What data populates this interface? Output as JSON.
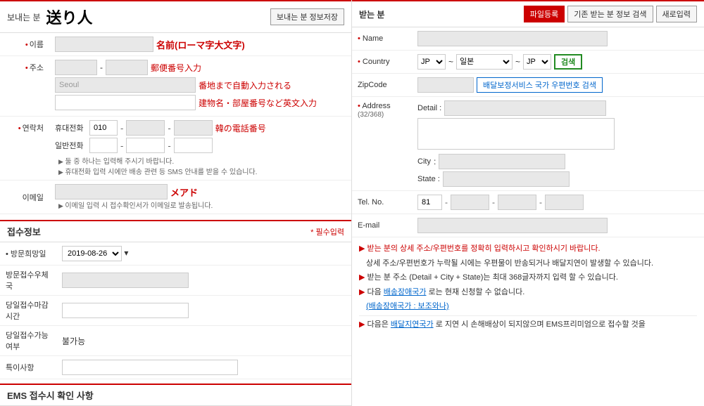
{
  "left": {
    "sender_section": {
      "title_small": "보내는 분",
      "title_large": "送り人",
      "save_btn": "보내는 분 정보저장"
    },
    "form": {
      "name_label": "이름",
      "name_annotation": "名前(ローマ字大文字)",
      "name_placeholder": "",
      "address_label": "주소",
      "postal_annotation": "郵便番号入力",
      "postal_placeholder": "",
      "postal_input2": "",
      "address_line1": "Seoul",
      "address_annotation1": "番地まで自動入力される",
      "address_line2": "",
      "address_annotation2": "建物名・部屋番号など英文入力",
      "contact_label": "연락처",
      "mobile_label": "휴대전화",
      "mobile_prefix": "010",
      "mobile_2": "",
      "mobile_3": "",
      "mobile_annotation": "韓の電話番号",
      "landline_label": "일반전화",
      "landline_2": "",
      "landline_3": "",
      "note1": "둘 중 하나는 입력해 주시기 바랍니다.",
      "note2": "휴대전화 입력 시에만 배송 관련 등 SMS 안내를 받을 수 있습니다.",
      "email_label": "이메일",
      "email_annotation": "メアド",
      "email_placeholder": "",
      "email_note": "이메일 입력 시 접수확인서가 이메일로 발송됩니다."
    },
    "reception_section": {
      "title": "접수정보",
      "required": "* 필수입력",
      "visit_date_label": "• 방문희망일",
      "visit_date_value": "2019-08-26",
      "visit_country_label": "방문접수우체국",
      "visit_country_value": "",
      "same_day_time_label": "당일접수마감시간",
      "same_day_time_value": "",
      "same_day_avail_label": "당일접수가능여부",
      "same_day_avail_value": "불가능",
      "special_label": "특이사항",
      "special_value": ""
    },
    "ems_section": {
      "title": "EMS 접수시 확인 사항"
    }
  },
  "right": {
    "receiver_section": {
      "title": "받는 분",
      "btn_file": "파일등록",
      "btn_search": "기존 받는 분 정보 검색",
      "btn_new": "새로입력"
    },
    "form": {
      "name_label": "Name",
      "name_value": "",
      "country_label": "Country",
      "country_code": "JP",
      "country_separator": "~",
      "country_name": "일본",
      "country_dash": "~",
      "country_jp": "JP",
      "search_btn": "검색",
      "zipcode_label": "ZipCode",
      "zipcode_value": "",
      "zipcode_search_btn": "배달보정서비스 국가 우편번호 검색",
      "detail_label": "Detail :",
      "detail_value": "",
      "address_label": "Address\n(32/368)",
      "address_label_short": "Address",
      "address_chars": "(32/368)",
      "city_label": "City",
      "city_value": "",
      "state_label": "State :",
      "state_value": "",
      "tel_label": "Tel. No.",
      "tel_country": "81",
      "tel_2": "",
      "tel_3": "",
      "tel_4": "",
      "email_label": "E-mail",
      "email_value": ""
    },
    "notes": {
      "note1_arrow": "▶",
      "note1": "받는 분의 상세 주소/우편번호를 정확히 입력하시고 확인하시기 바랍니다.",
      "note2": "상세 주소/우편번호가 누락될 시에는 우편물이 반송되거나 배달지연이 발생할 수 있습니다.",
      "note3_arrow": "▶",
      "note3": "받는 분 주소 (Detail + City + State)는 최대 368글자까지 입력 할 수 있습니다.",
      "note4_arrow": "▶",
      "note4_prefix": "다음 ",
      "note4_link": "배송장애국가",
      "note4_suffix": "로는 현재 신청할 수 없습니다.",
      "note5_link": "(배송장애국가 : 보조와나)",
      "next_arrow": "▶",
      "next_text_prefix": "다음은 ",
      "next_link": "배달지연국가",
      "next_text_suffix": "로 지연 시 손해배상이 되지않으며 EMS프리미엄으로 접수할 것을"
    }
  }
}
